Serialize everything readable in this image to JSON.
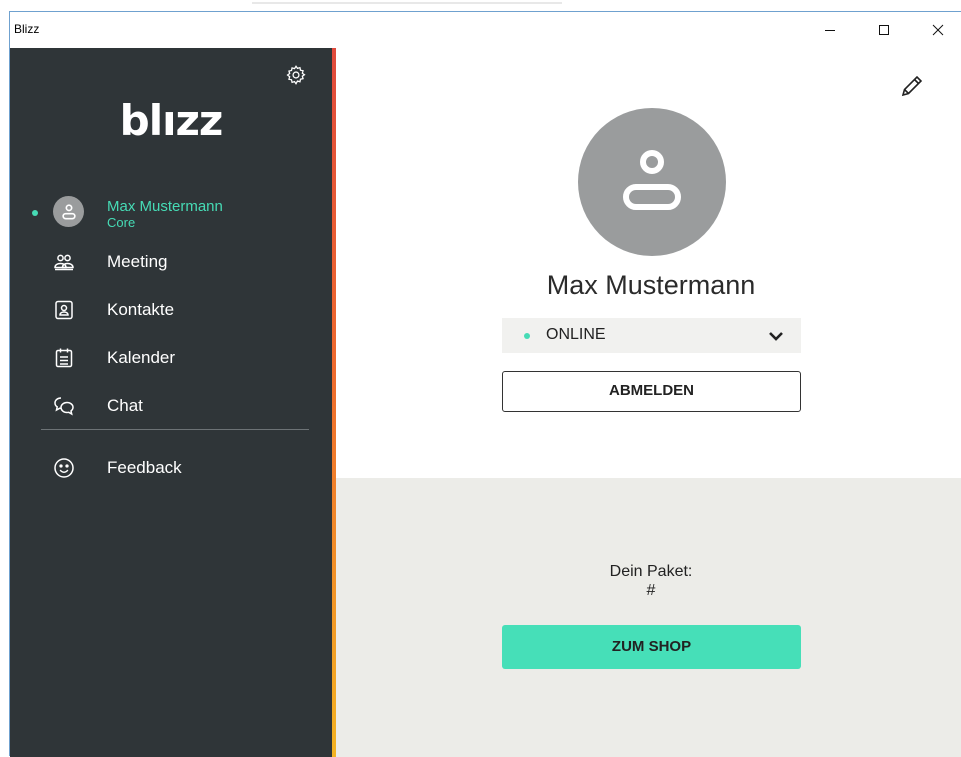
{
  "window": {
    "title": "Blizz",
    "controls": [
      "minimize",
      "maximize",
      "close"
    ]
  },
  "sidebar": {
    "logo_text": "blızz",
    "settings_icon": "gear-icon",
    "user": {
      "name": "Max Mustermann",
      "subtitle": "Core",
      "status": "online"
    },
    "items": [
      {
        "label": "Meeting",
        "icon": "group-icon"
      },
      {
        "label": "Kontakte",
        "icon": "contact-card-icon"
      },
      {
        "label": "Kalender",
        "icon": "calendar-icon"
      },
      {
        "label": "Chat",
        "icon": "chat-bubbles-icon"
      },
      {
        "label": "Feedback",
        "icon": "smiley-icon"
      }
    ]
  },
  "profile": {
    "edit_icon": "pencil-icon",
    "name": "Max Mustermann",
    "status_value": "ONLINE",
    "sign_out_label": "ABMELDEN"
  },
  "package": {
    "label": "Dein Paket:",
    "value": "#",
    "shop_label": "ZUM SHOP"
  },
  "colors": {
    "sidebar_bg": "#2f3538",
    "accent_green": "#46dbb5",
    "bottom_panel_bg": "#ecece8",
    "avatar_gray": "#9a9c9d"
  }
}
